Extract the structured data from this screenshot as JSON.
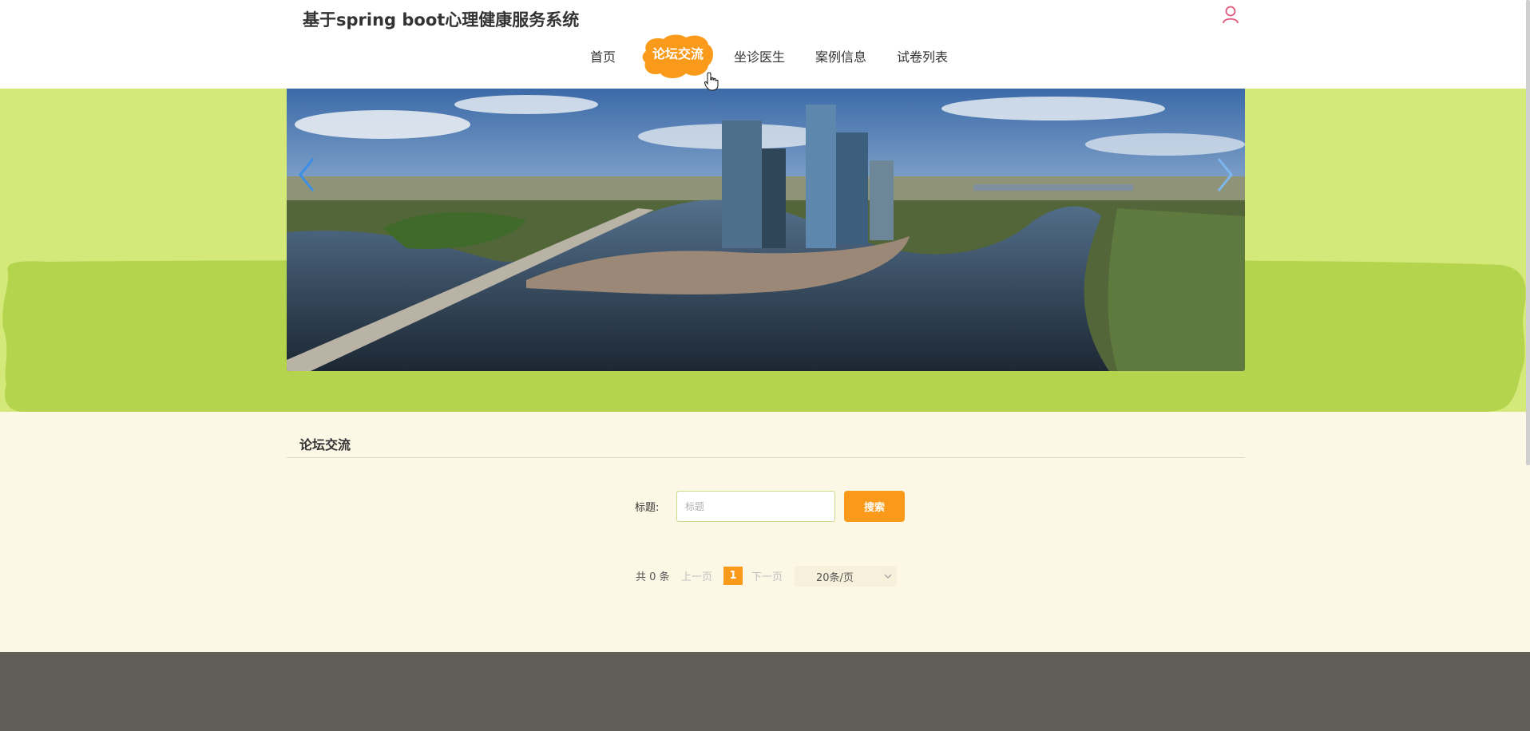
{
  "header": {
    "site_title": "基于spring boot心理健康服务系统",
    "user_icon": "user-icon"
  },
  "nav": {
    "items": [
      {
        "label": "首页",
        "active": false
      },
      {
        "label": "论坛交流",
        "active": true
      },
      {
        "label": "坐诊医生",
        "active": false
      },
      {
        "label": "案例信息",
        "active": false
      },
      {
        "label": "试卷列表",
        "active": false
      }
    ],
    "active_color": "#fa9a1a"
  },
  "banner": {
    "prev_icon": "chevron-left-icon",
    "next_icon": "chevron-right-icon"
  },
  "main": {
    "section_title": "论坛交流",
    "search": {
      "label": "标题:",
      "placeholder": "标题",
      "value": "",
      "button_label": "搜索"
    },
    "pagination": {
      "total": "共 0 条",
      "prev": "上一页",
      "current_page": "1",
      "next": "下一页",
      "page_size": "20条/页"
    }
  },
  "colors": {
    "accent": "#fa9a1a",
    "hero_green": "#d4e97a",
    "brush_green": "#b4d44e",
    "page_bg": "#fdf7e6",
    "footer": "#5f5f57"
  }
}
